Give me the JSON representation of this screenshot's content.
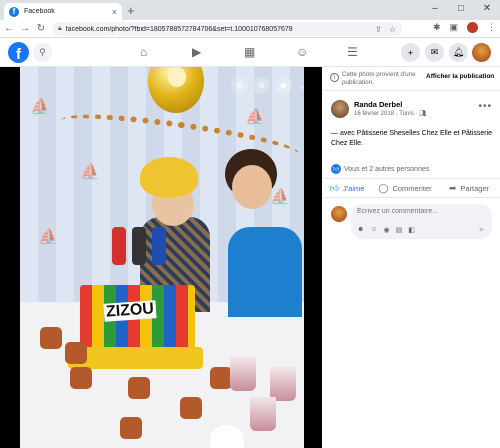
{
  "browser": {
    "tab_title": "Facebook",
    "tab_close": "×",
    "new_tab": "+",
    "window_controls": [
      "–",
      "□",
      "✕"
    ],
    "url": "facebook.com/photo/?fbid=1805788572784706&set=t.100010768057678",
    "nav": {
      "back": "←",
      "forward": "→",
      "reload": "↻"
    }
  },
  "facebook_header": {
    "logo": "f",
    "icons": [
      "search-icon",
      "home-icon",
      "video-icon",
      "marketplace-icon",
      "groups-icon",
      "menu-icon",
      "create-icon",
      "messenger-icon",
      "notifications-icon"
    ]
  },
  "photo": {
    "cake_text": "ZIZOU",
    "controls": [
      "zoom-in-icon",
      "zoom-out-icon",
      "tag-icon",
      "fullscreen-icon"
    ]
  },
  "panel": {
    "from_publication_text": "Cette photo provient d'une publication.",
    "from_publication_button": "Afficher la publication",
    "author": "Randa Derbel",
    "post_meta": "16 février 2018 · Tunis · ",
    "post_text": "— avec Pâtisserie Sheselles Chez Elle et Pâtisserie Chez Elle.",
    "reactions_text": "Vous et 2 autres personnes",
    "actions": {
      "like": "J'aime",
      "comment": "Commenter",
      "share": "Partager"
    },
    "comment_placeholder": "Écrivez un commentaire..."
  },
  "colors": {
    "facebook_blue": "#1877f2",
    "text_secondary": "#65676b",
    "photo_background": "#000000"
  }
}
